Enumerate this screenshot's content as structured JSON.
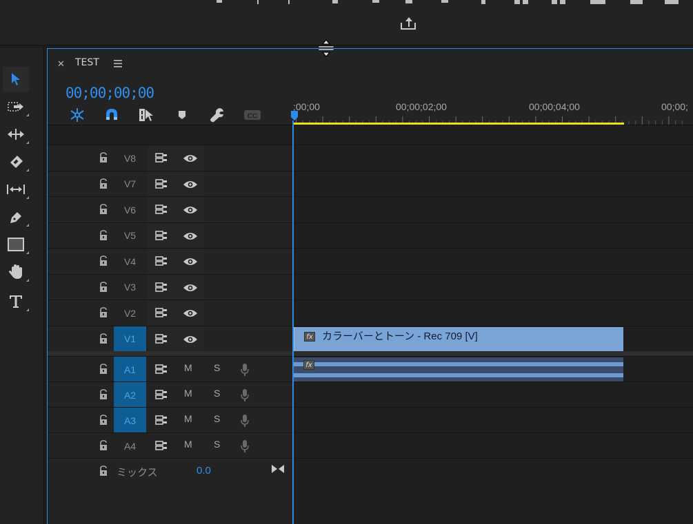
{
  "sequence": {
    "title": "TEST",
    "timecode": "00;00;00;00"
  },
  "ruler": {
    "labels": [
      ";00;00",
      "00;00;02;00",
      "00;00;04;00",
      "00;00;"
    ]
  },
  "video_tracks": [
    {
      "name": "V8",
      "targeted": false
    },
    {
      "name": "V7",
      "targeted": false
    },
    {
      "name": "V6",
      "targeted": false
    },
    {
      "name": "V5",
      "targeted": false
    },
    {
      "name": "V4",
      "targeted": false
    },
    {
      "name": "V3",
      "targeted": false
    },
    {
      "name": "V2",
      "targeted": false
    },
    {
      "name": "V1",
      "targeted": true
    }
  ],
  "audio_tracks": [
    {
      "name": "A1",
      "targeted": true,
      "mute_label": "M",
      "solo_label": "S"
    },
    {
      "name": "A2",
      "targeted": true,
      "mute_label": "M",
      "solo_label": "S"
    },
    {
      "name": "A3",
      "targeted": true,
      "mute_label": "M",
      "solo_label": "S"
    },
    {
      "name": "A4",
      "targeted": false,
      "mute_label": "M",
      "solo_label": "S"
    }
  ],
  "clips": {
    "video_fx": "fx",
    "video_label": "カラーバーとトーン - Rec 709 [V]",
    "audio_fx": "fx"
  },
  "mix": {
    "label": "ミックス",
    "value": "0.0"
  },
  "colors": {
    "accent": "#2e8ff0",
    "work_area": "#e8e412",
    "video_clip": "#7aa3d6",
    "track_target": "#0e5e95"
  }
}
